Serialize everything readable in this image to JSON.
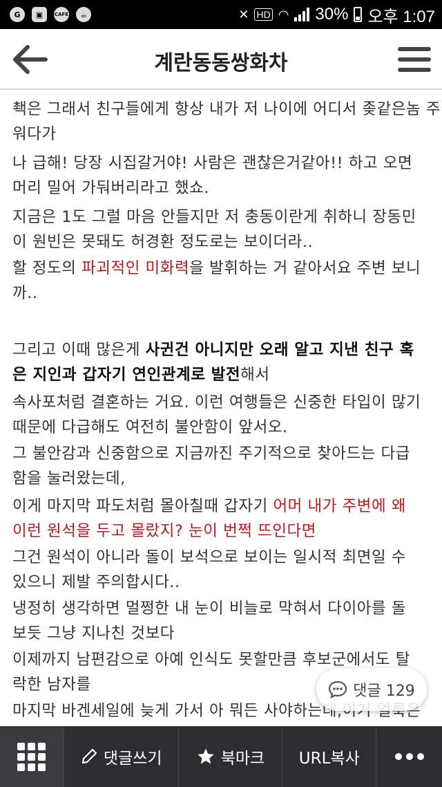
{
  "status_bar": {
    "battery": "30%",
    "time": "오후 1:07",
    "hd_label": "HD",
    "cafe_label": "CAFE"
  },
  "header": {
    "title": "계란동동쌍화차"
  },
  "content": {
    "p1": {
      "l1": "쵁은 그래서 친구들에게 항상 내가 저 나이에 어디서 좆같은놈 주",
      "l2": "워다가"
    },
    "p2": {
      "l1": "나 급해! 당장 시집갈거야! 사람은 괜찮은거같아!! 하고 오면",
      "l2": "머리 밀어 가둬버리라고 했쇼."
    },
    "p3": {
      "l1": "지금은 1도 그럴 마음 안들지만 저 충동이란게 취하니 장동민",
      "l2": "이 원빈은 못돼도 허경환 정도로는 보이더라.."
    },
    "p4": {
      "pre": "할 정도의 ",
      "red": "파괴적인 미화력",
      "post": "을 발휘하는 거 같아서요 주변 보니",
      "l2": "까.."
    },
    "p5": {
      "pre": "그리고 이때 많은게 ",
      "bold1": "사귄건 아니지만 오래 알고 지낸 친구 혹",
      "bold2": "은 지인과 갑자기 연인관계로 발전",
      "post": "해서"
    },
    "p6": {
      "l1": "속사포처럼 결혼하는 거요. 이런 여행들은 신중한 타입이 많기",
      "l2": "때문에 다급해도 여전히 불안함이 앞서오."
    },
    "p7": {
      "l1": "그 불안감과 신중함으로 지금까진 주기적으로 찾아드는 다급",
      "l2": "함을 눌러왔는데,"
    },
    "p8": {
      "pre": "이게 마지막 파도처럼 몰아칠때 갑자기 ",
      "red1": "어머 내가 주변에 왜",
      "red2": "이런 원석을 두고 몰랐지? 눈이 번쩍 뜨인다면"
    },
    "p9": {
      "l1": "그건 원석이 아니라 돌이 보석으로 보이는 일시적 최면일 수",
      "l2": "있으니 제발 주의합시다.."
    },
    "p10": {
      "l1": "냉정히 생각하면 멀쩡한 내 눈이 비늘로 막혀서 다이아를 돌",
      "l2": "보듯 그냥 지나친 것보다"
    },
    "p11": {
      "l1": "이제까지 남편감으로 아예 인식도 못할만큼 후보군에서도 탈",
      "l2": "락한 남자를"
    },
    "p12": {
      "l1": "마지막 바겐세일에 늦게 가서 아 뭐든 사야하는데,이거 얼룩은"
    }
  },
  "comment_badge": {
    "label": "댓글 129"
  },
  "bottom_bar": {
    "write_comment": "댓글쓰기",
    "bookmark": "북마크",
    "copy_url": "URL복사"
  },
  "icons": [
    "back-arrow-icon",
    "hamburger-menu-icon",
    "comment-bubble-icon",
    "grid-icon",
    "pencil-icon",
    "star-icon",
    "more-dots-icon"
  ]
}
